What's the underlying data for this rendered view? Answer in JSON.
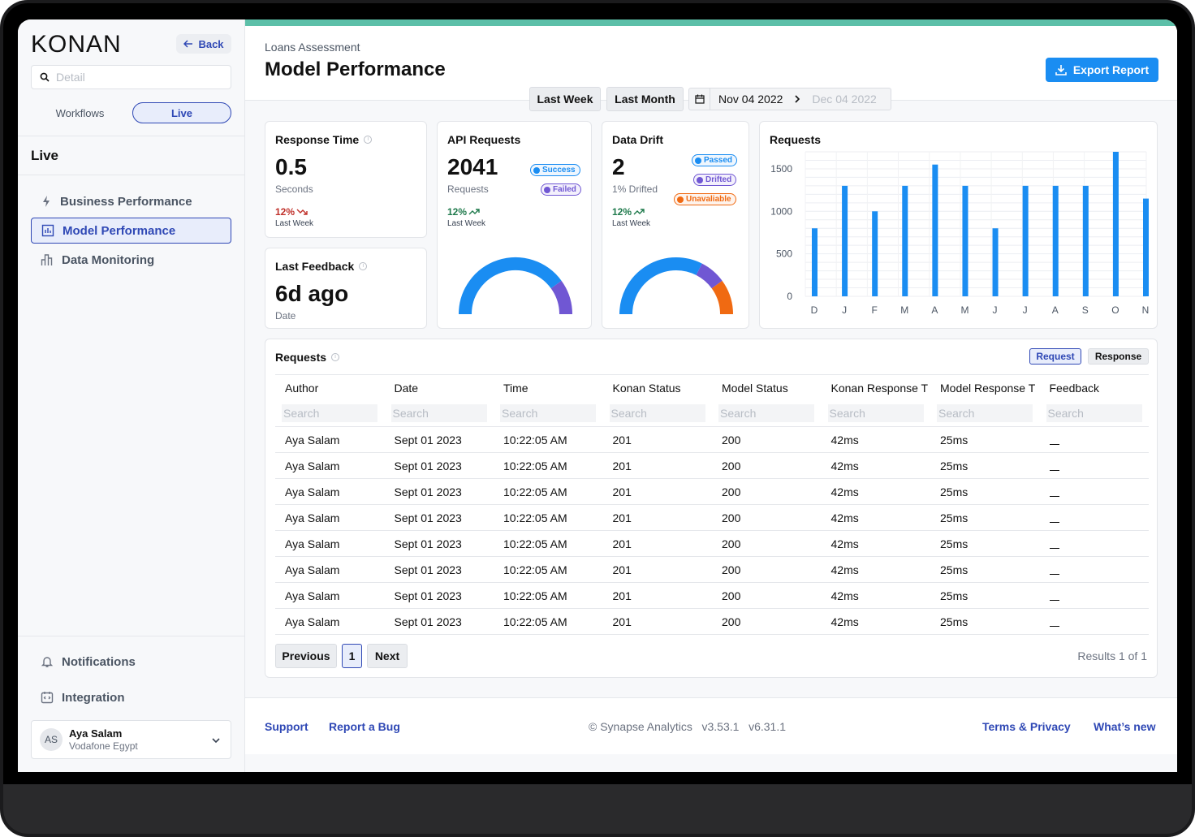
{
  "sidebar": {
    "logo": "KONAN",
    "back_label": "Back",
    "search_placeholder": "Detail",
    "tabs": {
      "workflows": "Workflows",
      "live": "Live"
    },
    "section_title": "Live",
    "nav": [
      {
        "label": "Business Performance",
        "icon": "bolt-icon"
      },
      {
        "label": "Model Performance",
        "icon": "chart-icon"
      },
      {
        "label": "Data Monitoring",
        "icon": "bar-chart-icon"
      }
    ],
    "notifications": "Notifications",
    "integration": "Integration",
    "user": {
      "initials": "AS",
      "name": "Aya Salam",
      "org": "Vodafone Egypt"
    }
  },
  "header": {
    "breadcrumb": "Loans Assessment",
    "title": "Model Performance",
    "export_label": "Export Report",
    "range_week": "Last Week",
    "range_month": "Last Month",
    "date_start": "Nov 04 2022",
    "date_end": "Dec 04 2022"
  },
  "cards": {
    "response_time": {
      "title": "Response Time",
      "value": "0.5",
      "unit": "Seconds",
      "trend": "12%",
      "trend_label": "Last Week"
    },
    "last_feedback": {
      "title": "Last Feedback",
      "value": "6d ago",
      "unit": "Date"
    },
    "api_requests": {
      "title": "API Requests",
      "value": "2041",
      "unit": "Requests",
      "trend": "12%",
      "trend_label": "Last Week",
      "badges": [
        "Success",
        "Failed"
      ]
    },
    "data_drift": {
      "title": "Data Drift",
      "value": "2",
      "unit": "1% Drifted",
      "trend": "12%",
      "trend_label": "Last Week",
      "badges": [
        "Passed",
        "Drifted",
        "Unavaliable"
      ]
    }
  },
  "colors": {
    "accent": "#1a8df2",
    "brand": "#2f48b5",
    "teal": "#5cbfa8",
    "purple": "#7057d3",
    "orange": "#f06a12"
  },
  "gauges": {
    "api_requests": [
      {
        "label": "Success",
        "fraction": 0.8
      },
      {
        "label": "Failed",
        "fraction": 0.2
      }
    ],
    "data_drift": [
      {
        "label": "Passed",
        "fraction": 0.65
      },
      {
        "label": "Drifted",
        "fraction": 0.15
      },
      {
        "label": "Unavaliable",
        "fraction": 0.2
      }
    ]
  },
  "chart_data": {
    "type": "bar",
    "title": "Requests",
    "categories": [
      "D",
      "J",
      "F",
      "M",
      "A",
      "M",
      "J",
      "J",
      "A",
      "S",
      "O",
      "N"
    ],
    "values": [
      800,
      1300,
      1000,
      1300,
      1550,
      1300,
      800,
      1300,
      1300,
      1300,
      1700,
      1150
    ],
    "yticks": [
      0,
      500,
      1000,
      1500
    ],
    "ylim": [
      0,
      1700
    ],
    "grid": true
  },
  "requests_table": {
    "title": "Requests",
    "toggle_request": "Request",
    "toggle_response": "Response",
    "columns": [
      "Author",
      "Date",
      "Time",
      "Konan Status",
      "Model Status",
      "Konan Response T",
      "Model Response T",
      "Feedback"
    ],
    "filter_placeholder": "Search",
    "rows": [
      [
        "Aya Salam",
        "Sept 01 2023",
        "10:22:05 AM",
        "201",
        "200",
        "42ms",
        "25ms",
        ""
      ],
      [
        "Aya Salam",
        "Sept 01 2023",
        "10:22:05 AM",
        "201",
        "200",
        "42ms",
        "25ms",
        ""
      ],
      [
        "Aya Salam",
        "Sept 01 2023",
        "10:22:05 AM",
        "201",
        "200",
        "42ms",
        "25ms",
        ""
      ],
      [
        "Aya Salam",
        "Sept 01 2023",
        "10:22:05 AM",
        "201",
        "200",
        "42ms",
        "25ms",
        ""
      ],
      [
        "Aya Salam",
        "Sept 01 2023",
        "10:22:05 AM",
        "201",
        "200",
        "42ms",
        "25ms",
        ""
      ],
      [
        "Aya Salam",
        "Sept 01 2023",
        "10:22:05 AM",
        "201",
        "200",
        "42ms",
        "25ms",
        ""
      ],
      [
        "Aya Salam",
        "Sept 01 2023",
        "10:22:05 AM",
        "201",
        "200",
        "42ms",
        "25ms",
        ""
      ],
      [
        "Aya Salam",
        "Sept 01 2023",
        "10:22:05 AM",
        "201",
        "200",
        "42ms",
        "25ms",
        ""
      ]
    ],
    "pager": {
      "previous": "Previous",
      "page": "1",
      "next": "Next",
      "results": "Results 1 of 1"
    }
  },
  "footer": {
    "support": "Support",
    "report_bug": "Report a Bug",
    "copyright": "© Synapse Analytics   v3.53.1   v6.31.1",
    "terms": "Terms &  Privacy",
    "whats_new": "What’s new"
  }
}
